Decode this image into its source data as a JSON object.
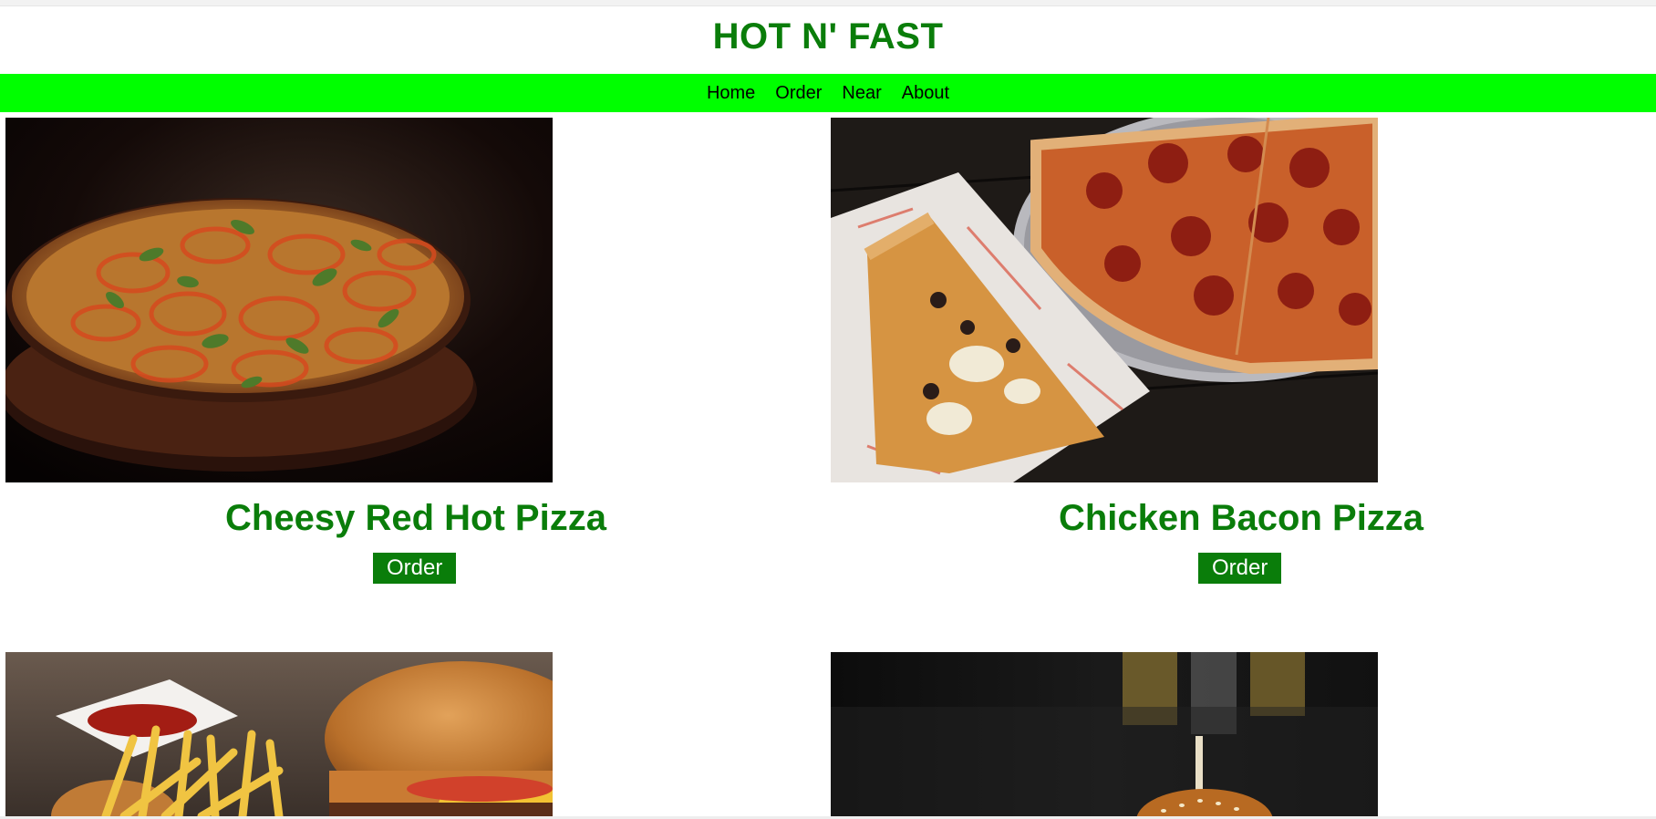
{
  "header": {
    "title": "HOT N' FAST"
  },
  "nav": {
    "items": [
      {
        "label": "Home"
      },
      {
        "label": "Order"
      },
      {
        "label": "Near"
      },
      {
        "label": "About"
      }
    ]
  },
  "menu": {
    "items": [
      {
        "name": "Cheesy Red Hot Pizza",
        "button_label": "Order",
        "image": "pizza-on-dark-plate-photo"
      },
      {
        "name": "Chicken Bacon Pizza",
        "button_label": "Order",
        "image": "pepperoni-and-olive-pizza-slices-photo"
      },
      {
        "name": "",
        "button_label": "",
        "image": "burger-with-fries-photo"
      },
      {
        "name": "",
        "button_label": "",
        "image": "sesame-burger-on-dark-background-photo"
      }
    ]
  },
  "colors": {
    "brand_green": "#0a7d0a",
    "nav_green": "#00ff00",
    "button_text": "#ffffff"
  }
}
